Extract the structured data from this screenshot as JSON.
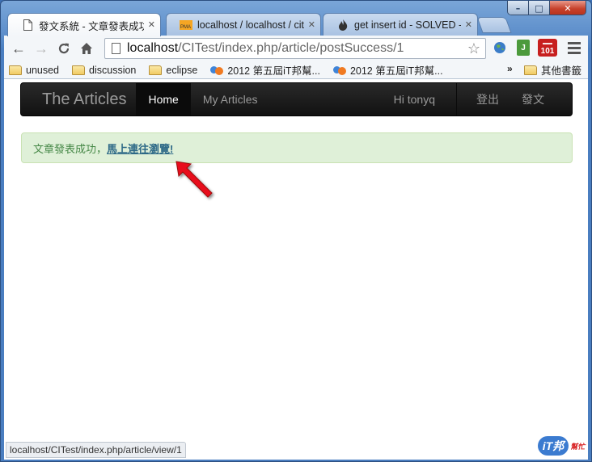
{
  "window": {
    "minimize": "–",
    "maximize": "□",
    "close": "✕"
  },
  "tabs": [
    {
      "label": "發文系統 - 文章發表成功",
      "icon": "page-icon",
      "active": true
    },
    {
      "label": "localhost / localhost / cit",
      "icon": "pma-icon",
      "icon_text": "PMA",
      "active": false
    },
    {
      "label": "get insert id - SOLVED - tl",
      "icon": "codeigniter-flame-icon",
      "active": false
    }
  ],
  "toolbar": {
    "back": "←",
    "forward": "→",
    "reload": "C",
    "home": "⌂",
    "url_host": "localhost",
    "url_path": "/CITest/index.php/article/postSuccess/1",
    "star": "☆",
    "ext_101": "101",
    "ext_green": "J"
  },
  "bookmarks": {
    "items": [
      {
        "label": "unused",
        "icon": "folder-icon"
      },
      {
        "label": "discussion",
        "icon": "folder-icon"
      },
      {
        "label": "eclipse",
        "icon": "folder-icon"
      },
      {
        "label": "2012 第五屆iT邦幫...",
        "icon": "ithome-icon"
      },
      {
        "label": "2012 第五屆iT邦幫...",
        "icon": "ithome-icon"
      }
    ],
    "overflow": "»",
    "other": "其他書籤"
  },
  "page": {
    "brand": "The Articles",
    "nav": [
      {
        "label": "Home",
        "active": true
      },
      {
        "label": "My Articles",
        "active": false
      }
    ],
    "greeting": "Hi tonyq",
    "logout": "登出",
    "post": "發文",
    "alert_text": "文章發表成功，",
    "alert_link": "馬上連往瀏覽!"
  },
  "statusbar": {
    "url": "localhost/CITest/index.php/article/view/1"
  },
  "watermark": {
    "main": "iT邦",
    "sub": "幫忙"
  },
  "colors": {
    "navbar": "#1b1b1b",
    "alert_bg": "#dff0d8",
    "alert_text": "#468847",
    "arrow": "#e8111b"
  }
}
